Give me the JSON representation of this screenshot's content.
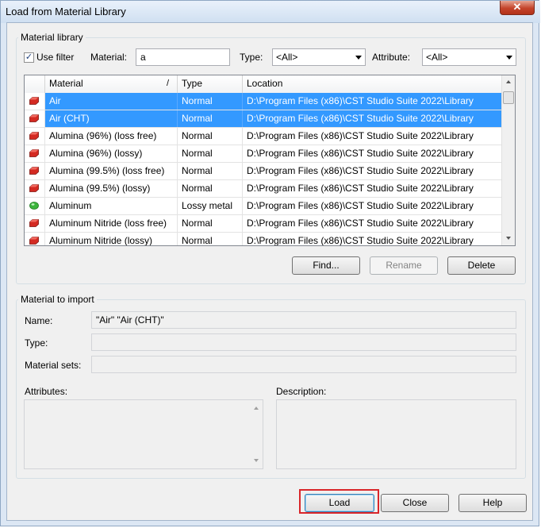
{
  "window": {
    "title": "Load from Material Library"
  },
  "library": {
    "group_label": "Material library",
    "use_filter_label": "Use filter",
    "use_filter_checked": true,
    "material_label": "Material:",
    "material_value": "a",
    "type_label": "Type:",
    "type_value": "<All>",
    "attribute_label": "Attribute:",
    "attribute_value": "<All>",
    "columns": {
      "material": "Material",
      "type": "Type",
      "location": "Location"
    },
    "sort_glyph": "/",
    "rows": [
      {
        "material": "Air",
        "type": "Normal",
        "location": "D:\\Program Files (x86)\\CST Studio Suite 2022\\Library",
        "selected": true,
        "icon": "red-brick-icon"
      },
      {
        "material": "Air (CHT)",
        "type": "Normal",
        "location": "D:\\Program Files (x86)\\CST Studio Suite 2022\\Library",
        "selected": true,
        "icon": "red-brick-icon"
      },
      {
        "material": "Alumina (96%) (loss free)",
        "type": "Normal",
        "location": "D:\\Program Files (x86)\\CST Studio Suite 2022\\Library",
        "selected": false,
        "icon": "red-brick-icon"
      },
      {
        "material": "Alumina (96%) (lossy)",
        "type": "Normal",
        "location": "D:\\Program Files (x86)\\CST Studio Suite 2022\\Library",
        "selected": false,
        "icon": "red-brick-icon"
      },
      {
        "material": "Alumina (99.5%) (loss free)",
        "type": "Normal",
        "location": "D:\\Program Files (x86)\\CST Studio Suite 2022\\Library",
        "selected": false,
        "icon": "red-brick-icon"
      },
      {
        "material": "Alumina (99.5%) (lossy)",
        "type": "Normal",
        "location": "D:\\Program Files (x86)\\CST Studio Suite 2022\\Library",
        "selected": false,
        "icon": "red-brick-icon"
      },
      {
        "material": "Aluminum",
        "type": "Lossy metal",
        "location": "D:\\Program Files (x86)\\CST Studio Suite 2022\\Library",
        "selected": false,
        "icon": "green-metal-icon"
      },
      {
        "material": "Aluminum Nitride (loss free)",
        "type": "Normal",
        "location": "D:\\Program Files (x86)\\CST Studio Suite 2022\\Library",
        "selected": false,
        "icon": "red-brick-icon"
      },
      {
        "material": "Aluminum Nitride (lossy)",
        "type": "Normal",
        "location": "D:\\Program Files (x86)\\CST Studio Suite 2022\\Library",
        "selected": false,
        "icon": "red-brick-icon"
      }
    ],
    "find_label": "Find...",
    "rename_label": "Rename",
    "delete_label": "Delete"
  },
  "import": {
    "group_label": "Material to import",
    "name_label": "Name:",
    "name_value": "\"Air\" \"Air (CHT)\"",
    "type_label": "Type:",
    "type_value": "",
    "sets_label": "Material sets:",
    "sets_value": "",
    "attributes_label": "Attributes:",
    "description_label": "Description:"
  },
  "footer": {
    "load_label": "Load",
    "close_label": "Close",
    "help_label": "Help"
  },
  "colors": {
    "selection": "#3399ff",
    "highlight_outline": "#d9262a",
    "brick_red": "#d42a22",
    "metal_green": "#3cb43c"
  }
}
